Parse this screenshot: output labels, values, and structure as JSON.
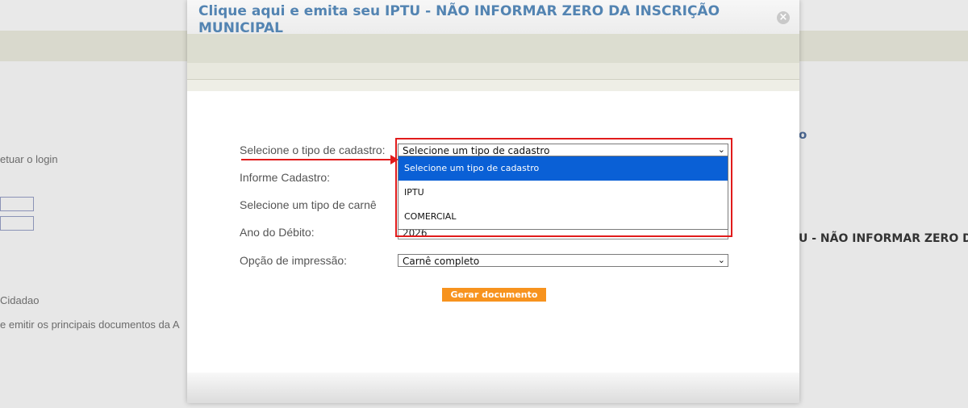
{
  "background": {
    "login_hint": "etuar o login",
    "cidadao": "Cidadao",
    "description": "e emitir os principais documentos da A",
    "link_fragment": "o",
    "title_fragment": "U - NÃO INFORMAR ZERO D"
  },
  "modal": {
    "title": "Clique aqui e emita seu IPTU - NÃO INFORMAR ZERO DA INSCRIÇÃO MUNICIPAL",
    "close_glyph": "×",
    "form": {
      "tipo_cadastro_label": "Selecione o tipo de cadastro:",
      "tipo_cadastro_value": "Selecione um tipo de cadastro",
      "informe_cadastro_label": "Informe Cadastro:",
      "tipo_carne_label": "Selecione um tipo de carnê",
      "ano_debito_label": "Ano do Débito:",
      "ano_debito_value": "2026",
      "opcao_impressao_label": "Opção de impressão:",
      "opcao_impressao_value": "Carnê completo"
    },
    "dropdown_options": [
      "Selecione um tipo de cadastro",
      "IPTU",
      "COMERCIAL"
    ],
    "generate_button": "Gerar documento"
  },
  "colors": {
    "title": "#5384b2",
    "highlight": "#e11b1b",
    "option_selected": "#0a60d6",
    "button": "#f7931e"
  }
}
